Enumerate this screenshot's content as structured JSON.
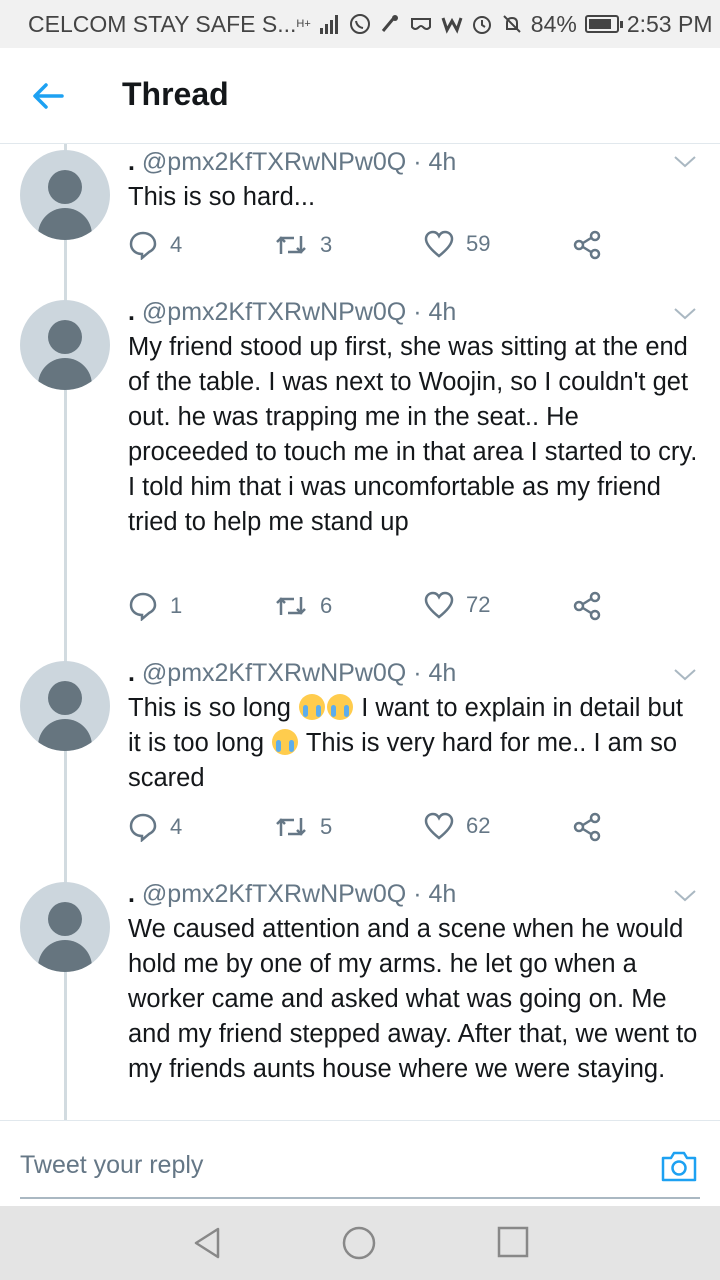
{
  "status_bar": {
    "carrier": "CELCOM STAY SAFE S...",
    "icons": [
      "network-hplus-icon",
      "signal-bars-icon",
      "whatsapp-icon",
      "brush-icon",
      "vr-icon",
      "w-icon",
      "alarm-icon",
      "mute-icon",
      "battery-icon"
    ],
    "network_label": "H+",
    "battery_percent": "84%",
    "battery_level": 0.84,
    "time": "2:53 PM"
  },
  "header": {
    "title": "Thread"
  },
  "tweets": [
    {
      "dot": ".",
      "handle": "@pmx2KfTXRwNPw0Q",
      "separator": "·",
      "time": "4h",
      "text": "This is so hard...",
      "replies": "4",
      "retweets": "3",
      "likes": "59"
    },
    {
      "dot": ".",
      "handle": "@pmx2KfTXRwNPw0Q",
      "separator": "·",
      "time": "4h",
      "text": "My friend stood up first, she was sitting at the end of the table. I was next to Woojin, so I couldn't get out. he was trapping me in the seat.. He proceeded to touch me in that area I started to cry. I told him that i was uncomfortable as my friend tried to help me stand up",
      "replies": "1",
      "retweets": "6",
      "likes": "72"
    },
    {
      "dot": ".",
      "handle": "@pmx2KfTXRwNPw0Q",
      "separator": "·",
      "time": "4h",
      "text_parts": [
        "This is so long",
        "I want to explain in detail but it is too long",
        "This is very hard for me.. I am so scared"
      ],
      "emoji": "loudly-crying-face-emoji",
      "replies": "4",
      "retweets": "5",
      "likes": "62"
    },
    {
      "dot": ".",
      "handle": "@pmx2KfTXRwNPw0Q",
      "separator": "·",
      "time": "4h",
      "text": "We caused attention and a scene when he would hold me by one of my arms. he let go when a worker came and asked what was going on. Me and my friend stepped away. After that, we went to my friends aunts house where we were staying."
    }
  ],
  "reply_bar": {
    "placeholder": "Tweet your reply"
  },
  "colors": {
    "accent": "#1da1f2",
    "text": "#14171a",
    "secondary": "#657786",
    "avatar_bg": "#ccd6dd",
    "avatar_fg": "#66757f",
    "thread_line": "#d2dbe0"
  }
}
